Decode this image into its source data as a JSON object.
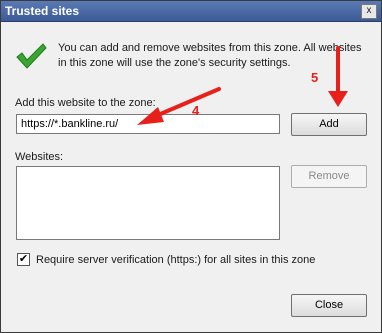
{
  "window": {
    "title": "Trusted sites",
    "close_glyph": "x"
  },
  "info": {
    "text": "You can add and remove websites from this zone. All websites in this zone will use the zone's security settings."
  },
  "add_site": {
    "label": "Add this website to the zone:",
    "value": "https://*.bankline.ru/"
  },
  "buttons": {
    "add": "Add",
    "remove": "Remove",
    "close": "Close"
  },
  "websites": {
    "label": "Websites:"
  },
  "https_check": {
    "label": "Require server verification (https:) for all sites in this zone",
    "checked": true,
    "mark": "✔"
  },
  "annotations": {
    "step_a": "4",
    "step_b": "5",
    "color": "#e8201a"
  }
}
